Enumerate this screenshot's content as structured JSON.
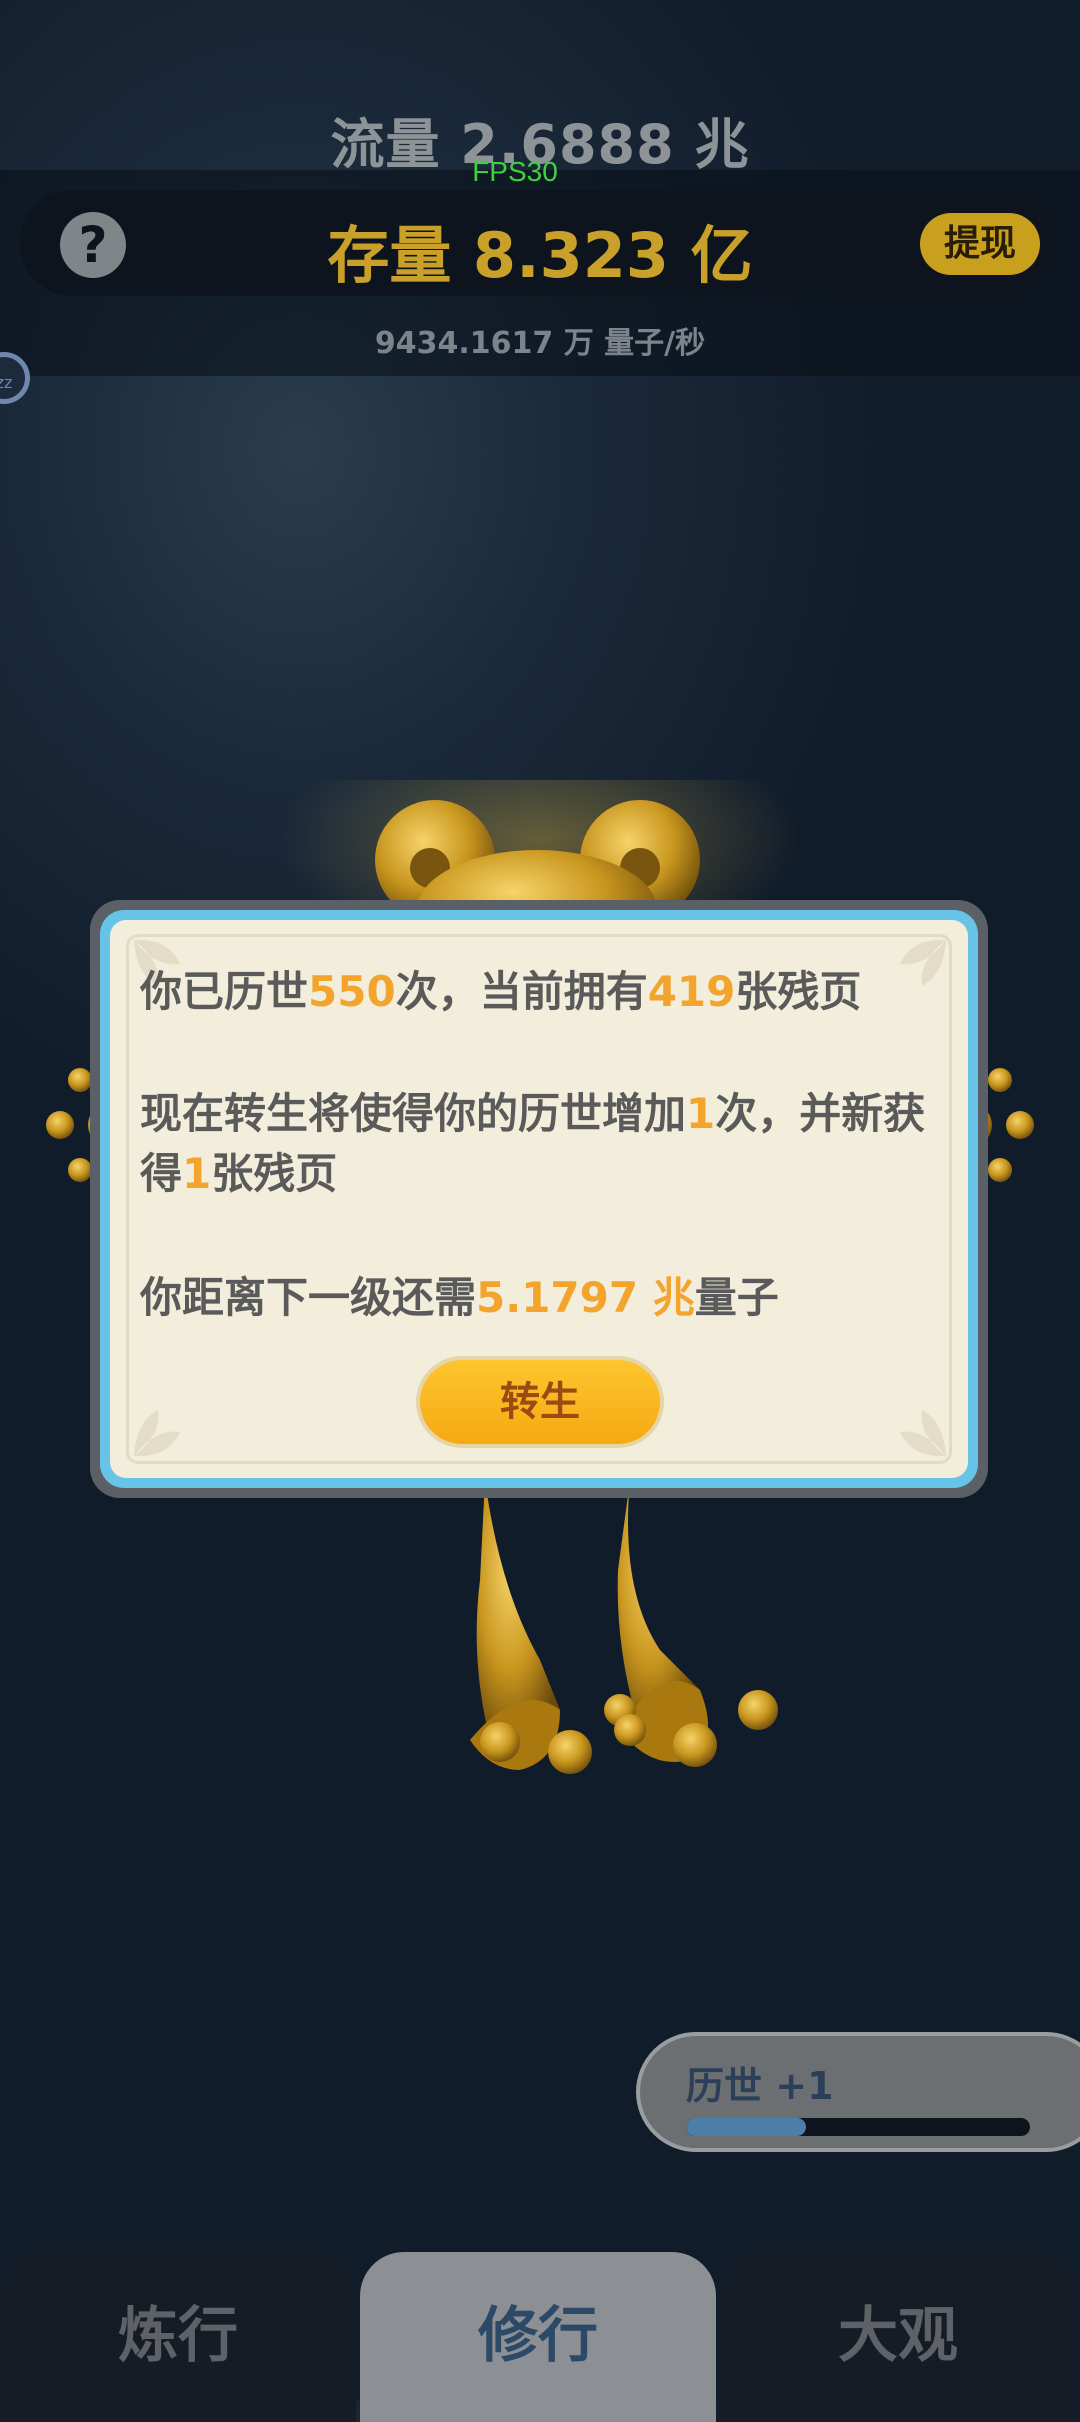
{
  "header": {
    "flow_text": "流量 2.6888 兆",
    "fps": "FPS30",
    "stock_text": "存量 8.323 亿",
    "help_symbol": "?",
    "withdraw_label": "提现",
    "rate_text": "9434.1617 万  量子/秒",
    "sleep_text": "zz"
  },
  "dialog": {
    "line1": {
      "a": "你已历世",
      "b": "550",
      "c": "次，当前拥有",
      "d": "419",
      "e": "张残页"
    },
    "line2": {
      "a": "现在转生将使得你的历世增加",
      "b": "1",
      "c": "次，并新获得",
      "d": "1",
      "e": "张残页"
    },
    "line3": {
      "a": "你距离下一级还需",
      "b": "5.1797 兆",
      "c": "量子"
    },
    "button_label": "转生"
  },
  "progress": {
    "label": "历世 +1",
    "fraction": 0.35
  },
  "tabs": [
    {
      "label": "炼行"
    },
    {
      "label": "修行"
    },
    {
      "label": "大观"
    }
  ],
  "colors": {
    "highlight": "#f2a42c",
    "gold": "#c9a02a",
    "active_tab_text": "#2c4a68"
  }
}
